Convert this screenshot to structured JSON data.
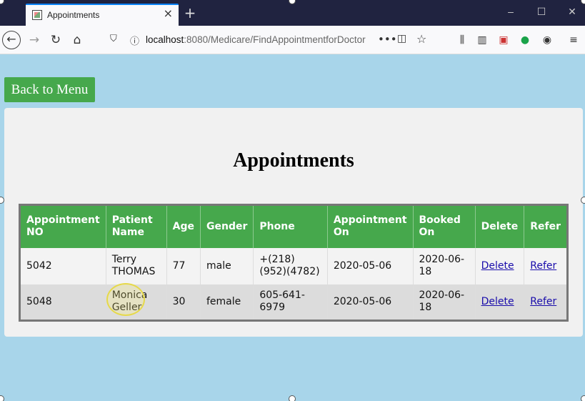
{
  "browser": {
    "tab_title": "Appointments",
    "tab_close": "×",
    "new_tab": "+",
    "url_host": "localhost",
    "url_rest": ":8080/Medicare/FindAppointmentforDoctor",
    "url_dots": "•••",
    "window_minimize": "–",
    "window_maximize": "☐",
    "window_close": "✕"
  },
  "page": {
    "back_label": "Back to Menu",
    "title": "Appointments"
  },
  "table": {
    "headers": [
      "Appointment NO",
      "Patient Name",
      "Age",
      "Gender",
      "Phone",
      "Appointment On",
      "Booked On",
      "Delete",
      "Refer"
    ],
    "rows": [
      {
        "id": "5042",
        "patient": "Terry THOMAS",
        "age": "77",
        "gender": "male",
        "phone": "+(218) (952)(4782)",
        "appointment_on": "2020-05-06",
        "booked_on": "2020-06-18",
        "delete": "Delete",
        "refer": "Refer"
      },
      {
        "id": "5048",
        "patient": "Monica Geller",
        "age": "30",
        "gender": "female",
        "phone": "605-641-6979",
        "appointment_on": "2020-05-06",
        "booked_on": "2020-06-18",
        "delete": "Delete",
        "refer": "Refer"
      }
    ]
  },
  "colors": {
    "accent_green": "#46a84c",
    "page_background": "#a8d5ea",
    "link": "#1a0dab"
  }
}
